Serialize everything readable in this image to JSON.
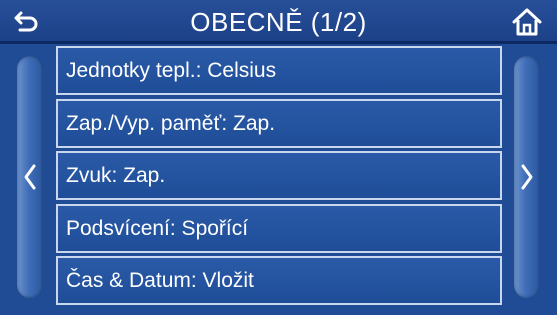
{
  "header": {
    "title": "OBECNĚ (1/2)",
    "back_icon": "back-arrow-icon",
    "home_icon": "home-icon"
  },
  "nav": {
    "prev_icon": "chevron-left-icon",
    "next_icon": "chevron-right-icon"
  },
  "menu": {
    "items": [
      {
        "label": "Jednotky tepl.: Celsius"
      },
      {
        "label": "Zap./Vyp. paměť: Zap."
      },
      {
        "label": "Zvuk: Zap."
      },
      {
        "label": "Podsvícení: Spořící"
      },
      {
        "label": "Čas & Datum: Vložit"
      }
    ]
  },
  "colors": {
    "background": "#1f4c95",
    "item_border": "#c9d7ee",
    "text": "#ffffff"
  }
}
